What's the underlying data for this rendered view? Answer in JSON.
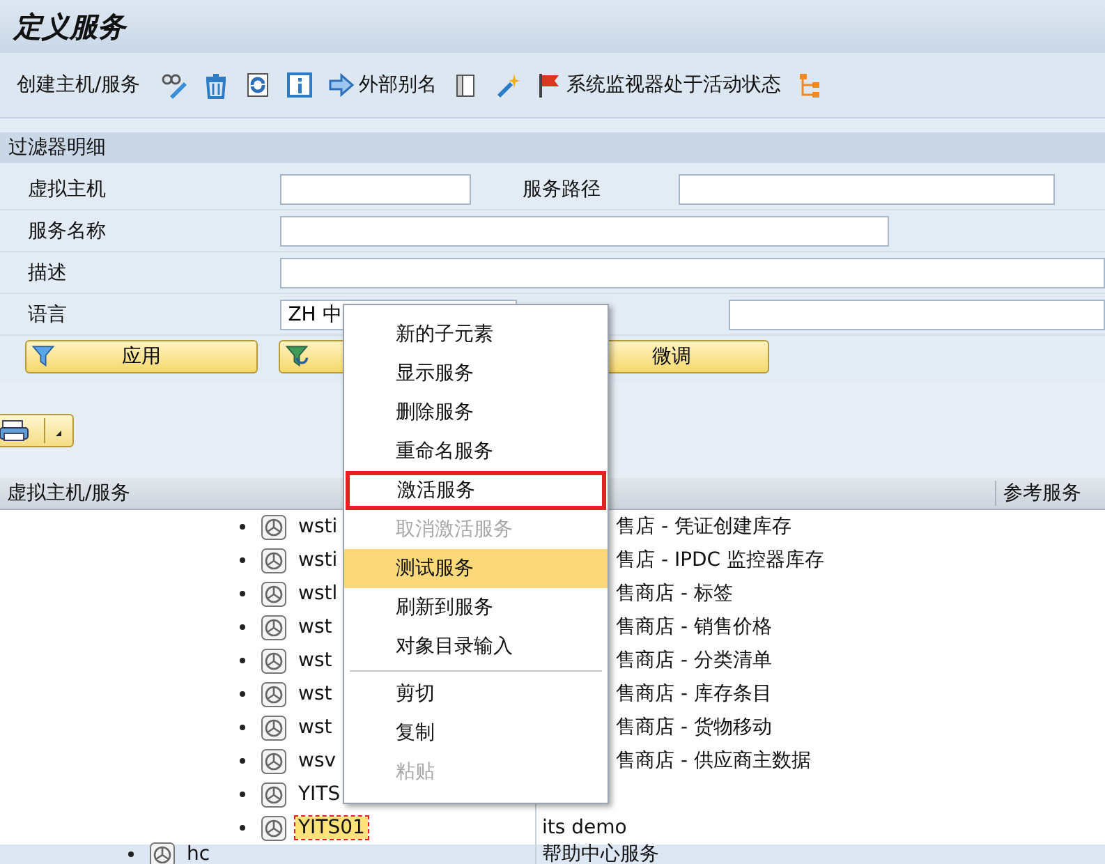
{
  "window": {
    "title": "定义服务"
  },
  "toolbar": [
    {
      "kind": "text",
      "label": "创建主机/服务"
    },
    {
      "kind": "icon"
    },
    {
      "kind": "icon"
    },
    {
      "kind": "icon"
    },
    {
      "kind": "icon"
    },
    {
      "kind": "icon_text",
      "label": "外部别名"
    },
    {
      "kind": "icon"
    },
    {
      "kind": "icon"
    },
    {
      "kind": "icon_text",
      "label": "系统监视器处于活动状态"
    },
    {
      "kind": "icon"
    }
  ],
  "filter": {
    "title": "过滤器明细",
    "fields": [
      {
        "label": "虚拟主机",
        "side_label": "服务路径",
        "side_field": true
      },
      {
        "label": "服务名称"
      },
      {
        "label": "描述"
      },
      {
        "label": "语言",
        "value": "ZH 中",
        "side_field": true
      }
    ],
    "buttons": [
      {
        "kind": "labeled",
        "label": "应用"
      },
      {
        "kind": "covered"
      },
      {
        "kind": "labeled",
        "label": "微调"
      }
    ]
  },
  "table": {
    "columns": [
      "虚拟主机/服务",
      "参考服务"
    ],
    "tree": [
      {
        "children": [
          {
            "name": "wsti",
            "description": "售店 - 凭证创建库存",
            "selected": false
          },
          {
            "name": "wsti",
            "description": "售店 - IPDC 监控器库存",
            "selected": false
          },
          {
            "name": "wstl",
            "description": "售商店 - 标签",
            "selected": false
          },
          {
            "name": "wst",
            "description": "售商店 - 销售价格",
            "selected": false
          },
          {
            "name": "wst",
            "description": "售商店 - 分类清单",
            "selected": false
          },
          {
            "name": "wst",
            "description": "售商店 - 库存条目",
            "selected": false
          },
          {
            "name": "wst",
            "description": "售商店 - 货物移动",
            "selected": false
          },
          {
            "name": "wsv",
            "description": "售商店 - 供应商主数据",
            "selected": false
          },
          {
            "name": "YITS",
            "selected": false
          },
          {
            "name": "YITS01",
            "description": "its demo",
            "selected": true
          }
        ]
      },
      {
        "name": "hc",
        "description": "帮助中心服务",
        "selected": false
      }
    ]
  },
  "context_menu": [
    {
      "kind": "item",
      "label": "新的子元素",
      "disabled": false,
      "selected": false,
      "framed": false
    },
    {
      "kind": "item",
      "label": "显示服务",
      "disabled": false,
      "selected": false,
      "framed": false
    },
    {
      "kind": "item",
      "label": "删除服务",
      "disabled": false,
      "selected": false,
      "framed": false
    },
    {
      "kind": "item",
      "label": "重命名服务",
      "disabled": false,
      "selected": false,
      "framed": false
    },
    {
      "kind": "item",
      "label": "激活服务",
      "disabled": false,
      "selected": false,
      "framed": true
    },
    {
      "kind": "item",
      "label": "取消激活服务",
      "disabled": true,
      "selected": false,
      "framed": false
    },
    {
      "kind": "item",
      "label": "测试服务",
      "disabled": false,
      "selected": true,
      "framed": false
    },
    {
      "kind": "item",
      "label": "刷新到服务",
      "disabled": false,
      "selected": false,
      "framed": false
    },
    {
      "kind": "item",
      "label": "对象目录输入",
      "disabled": false,
      "selected": false,
      "framed": false
    },
    {
      "kind": "separator"
    },
    {
      "kind": "item",
      "label": "剪切",
      "disabled": false,
      "selected": false,
      "framed": false
    },
    {
      "kind": "item",
      "label": "复制",
      "disabled": false,
      "selected": false,
      "framed": false
    },
    {
      "kind": "item",
      "label": "粘贴",
      "disabled": true,
      "selected": false,
      "framed": false
    }
  ]
}
